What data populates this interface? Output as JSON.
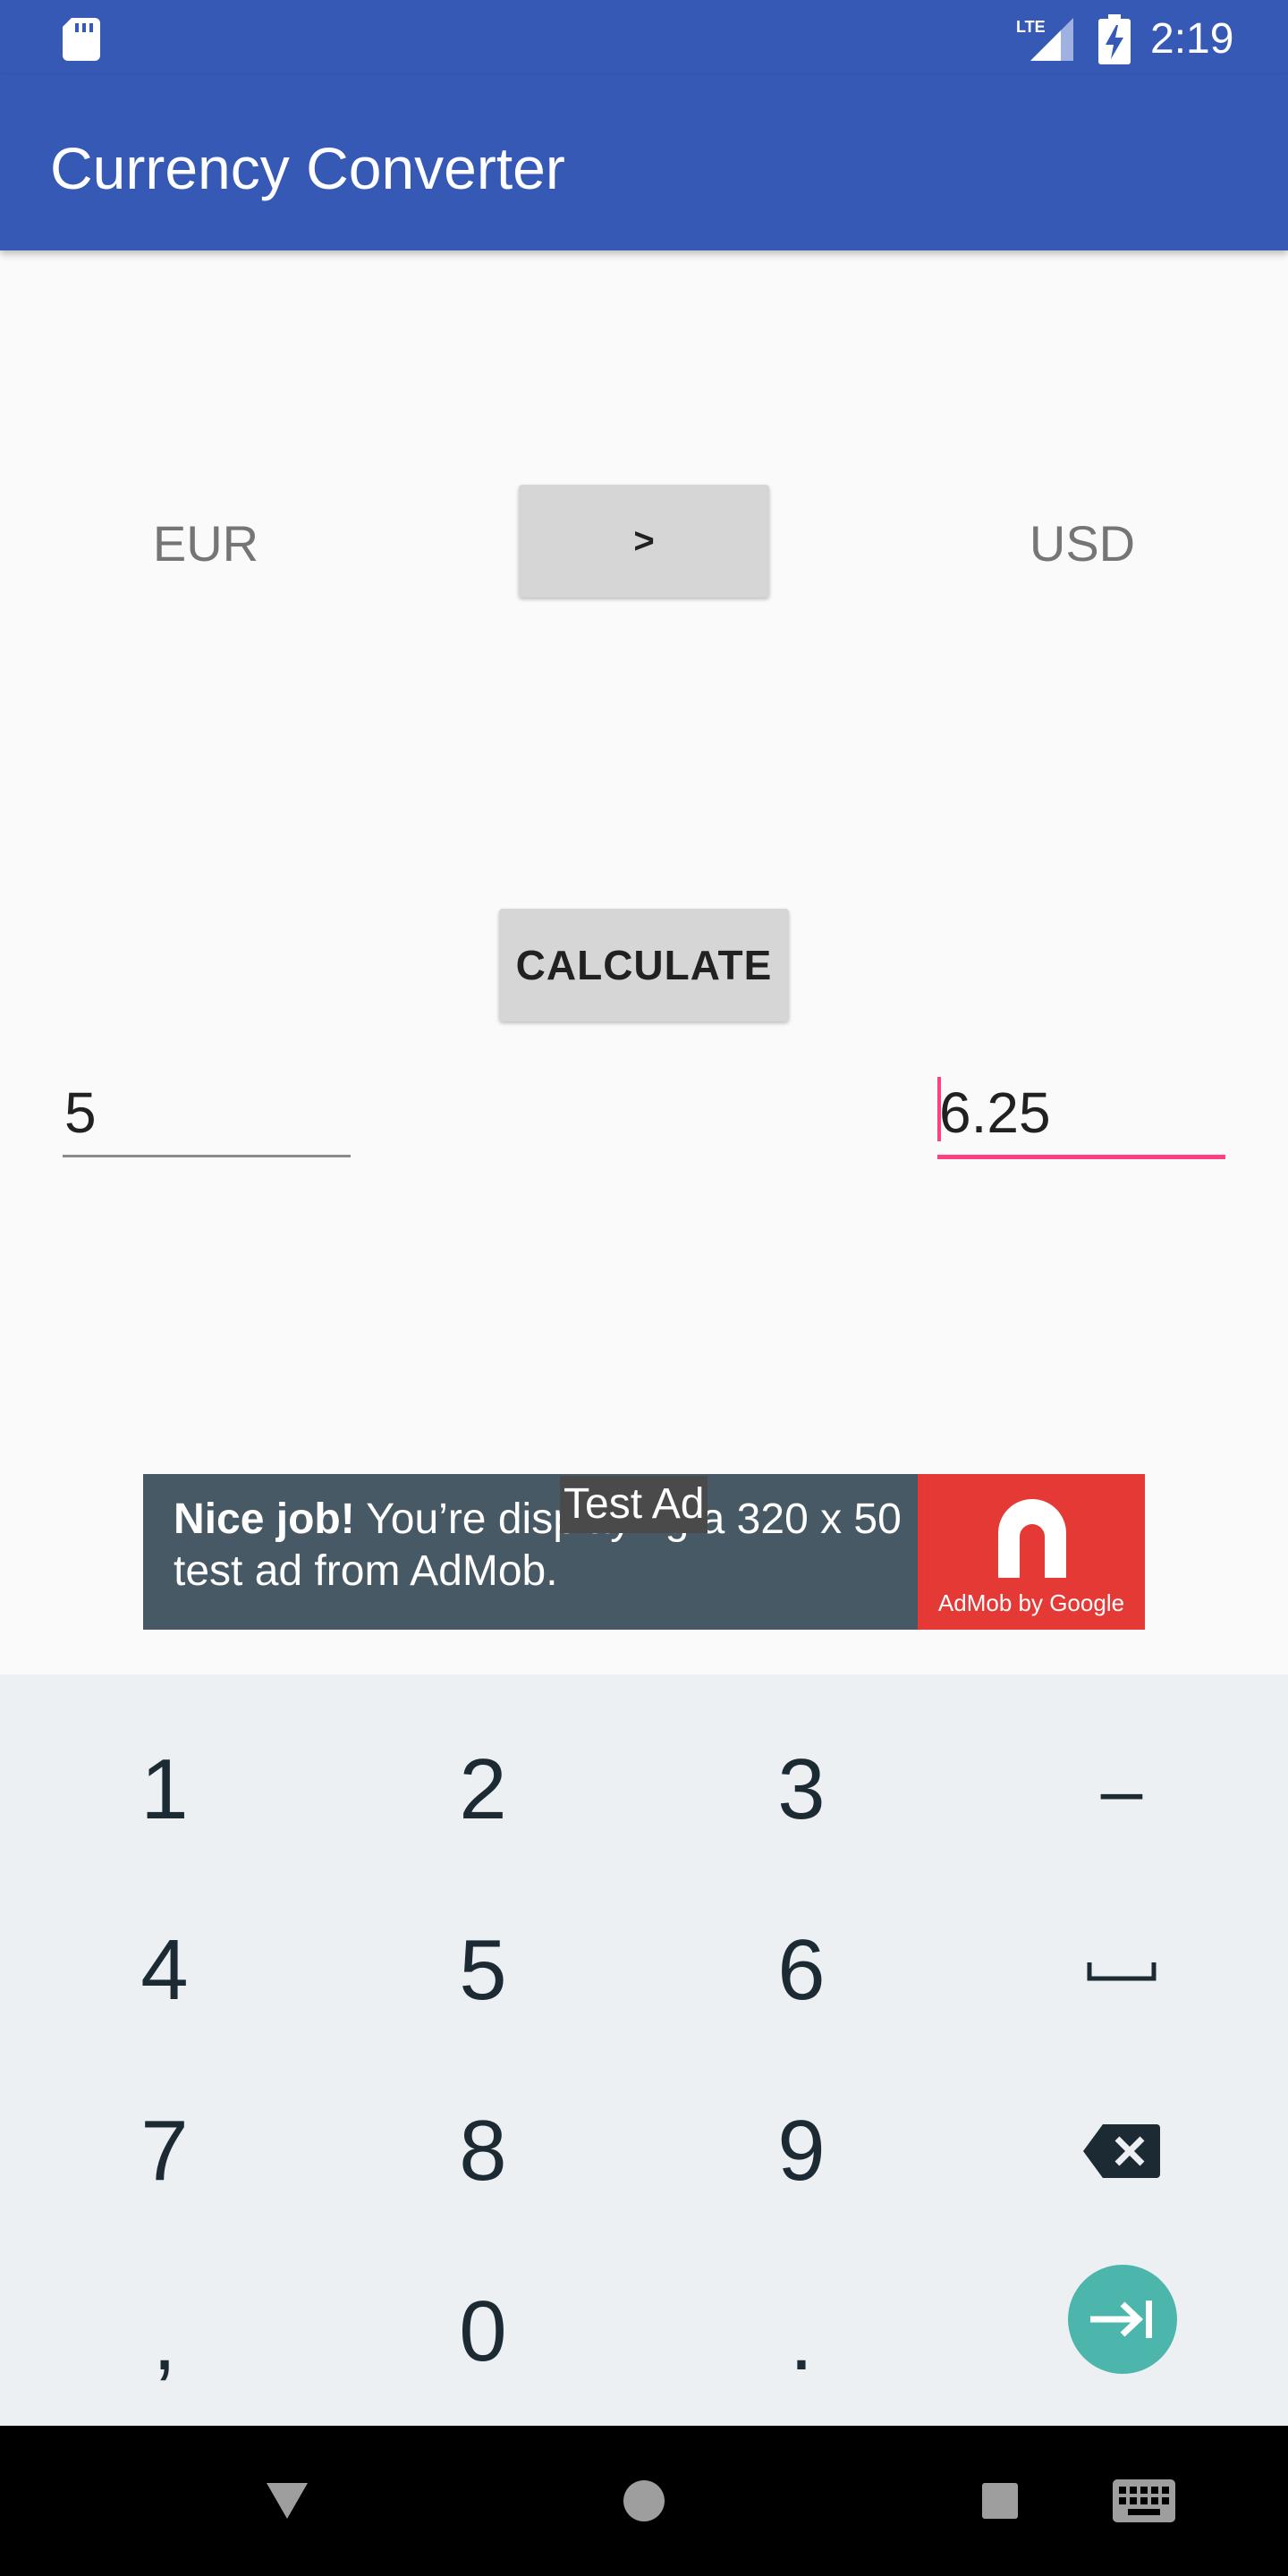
{
  "status_bar": {
    "time": "2:19",
    "network_label": "LTE",
    "icons": [
      "sd-card-icon",
      "lte-signal-icon",
      "battery-charging-icon"
    ]
  },
  "app_bar": {
    "title": "Currency Converter",
    "color": "#3559b5"
  },
  "converter": {
    "from_currency": "EUR",
    "to_currency": "USD",
    "swap_label": ">",
    "calculate_label": "CALCULATE",
    "amount_input": "5",
    "result_input": "6.25",
    "accent_color": "#ff4081"
  },
  "ad": {
    "text_bold": "Nice job!",
    "text_body": " You’re displaying a 320 x 50 test ad from AdMob.",
    "overlay_label": "Test Ad",
    "logo_caption": "AdMob by Google"
  },
  "keyboard": {
    "rows": [
      [
        "1",
        "2",
        "3",
        "–"
      ],
      [
        "4",
        "5",
        "6",
        "␣"
      ],
      [
        "7",
        "8",
        "9",
        "⌫"
      ],
      [
        ",",
        "0",
        ".",
        "⇥"
      ]
    ],
    "go_icon": "tab-next-icon",
    "go_color": "#4db6ac"
  },
  "nav_bar": {
    "items": [
      "back-icon",
      "home-icon",
      "recents-icon",
      "keyboard-switch-icon"
    ]
  }
}
